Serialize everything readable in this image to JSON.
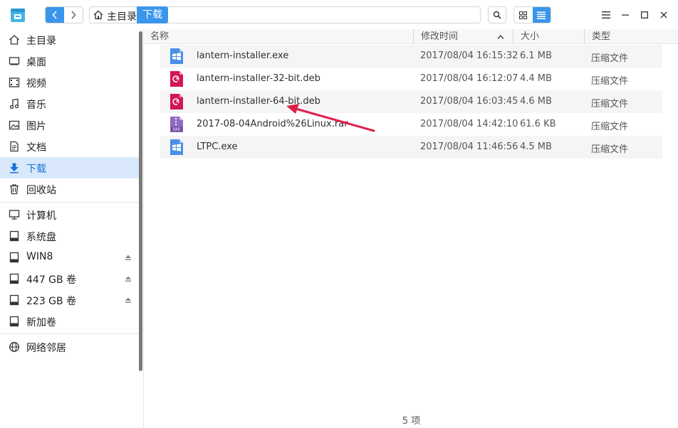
{
  "toolbar": {
    "back_icon": "chevron-left",
    "forward_icon": "chevron-right",
    "breadcrumb": {
      "home_label": "主目录",
      "current_label": "下载"
    },
    "search_icon": "search",
    "view_modes": [
      "grid-view",
      "list-view"
    ],
    "window_buttons": [
      "menu",
      "minimize",
      "maximize",
      "close"
    ],
    "accent_color": "#3a96ec"
  },
  "sidebar": {
    "items": [
      {
        "label": "主目录",
        "icon": "home-icon"
      },
      {
        "label": "桌面",
        "icon": "desktop-icon"
      },
      {
        "label": "视频",
        "icon": "video-icon"
      },
      {
        "label": "音乐",
        "icon": "music-icon"
      },
      {
        "label": "图片",
        "icon": "picture-icon"
      },
      {
        "label": "文档",
        "icon": "document-icon"
      },
      {
        "label": "下载",
        "icon": "download-icon",
        "active": true
      },
      {
        "label": "回收站",
        "icon": "trash-icon"
      },
      {
        "label": "计算机",
        "icon": "computer-icon"
      },
      {
        "label": "系统盘",
        "icon": "drive-icon"
      },
      {
        "label": "WIN8",
        "icon": "drive-icon",
        "ejectable": true
      },
      {
        "label": "447 GB 卷",
        "icon": "drive-icon",
        "ejectable": true
      },
      {
        "label": "223 GB 卷",
        "icon": "drive-icon",
        "ejectable": true
      },
      {
        "label": "新加卷",
        "icon": "drive-icon"
      },
      {
        "label": "网络邻居",
        "icon": "network-icon"
      }
    ]
  },
  "columns": {
    "name": "名称",
    "mtime": "修改时间",
    "size": "大小",
    "type": "类型"
  },
  "files": [
    {
      "name": "lantern-installer.exe",
      "mtime": "2017/08/04 16:15:32",
      "size": "6.1 MB",
      "type": "压缩文件",
      "icon": "exe-icon"
    },
    {
      "name": "lantern-installer-32-bit.deb",
      "mtime": "2017/08/04 16:12:07",
      "size": "4.4 MB",
      "type": "压缩文件",
      "icon": "deb-icon"
    },
    {
      "name": "lantern-installer-64-bit.deb",
      "mtime": "2017/08/04 16:03:45",
      "size": "4.6 MB",
      "type": "压缩文件",
      "icon": "deb-icon"
    },
    {
      "name": "2017-08-04Android%26Linux.rar",
      "mtime": "2017/08/04 14:42:10",
      "size": "61.6 KB",
      "type": "压缩文件",
      "icon": "rar-icon"
    },
    {
      "name": "LTPC.exe",
      "mtime": "2017/08/04 11:46:56",
      "size": "4.5 MB",
      "type": "压缩文件",
      "icon": "exe-icon"
    }
  ],
  "status": {
    "item_count": "5 项"
  },
  "annotation": {
    "arrow_color": "#e0204a",
    "points_to": "lantern-installer-64-bit.deb"
  }
}
